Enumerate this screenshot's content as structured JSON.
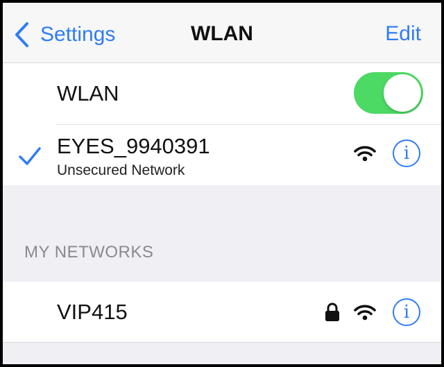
{
  "navbar": {
    "back_label": "Settings",
    "title": "WLAN",
    "edit_label": "Edit"
  },
  "wlan_toggle": {
    "label": "WLAN",
    "on": true,
    "color": "#4cd964"
  },
  "connected_network": {
    "name": "EYES_9940391",
    "subtitle": "Unsecured Network",
    "status_icon": "checkmark-icon",
    "icons": [
      "wifi-icon",
      "info-icon"
    ]
  },
  "my_networks": {
    "header": "MY NETWORKS",
    "items": [
      {
        "name": "VIP415",
        "icons": [
          "lock-icon",
          "wifi-icon",
          "info-icon"
        ]
      }
    ]
  },
  "colors": {
    "accent": "#2f7cf6",
    "background": "#efeff4",
    "section_header": "#8a8a8e"
  }
}
